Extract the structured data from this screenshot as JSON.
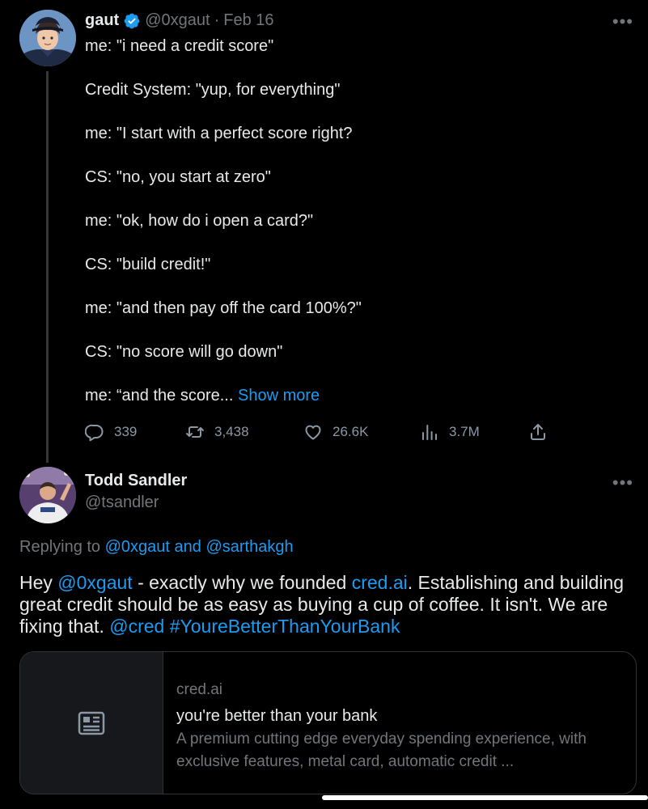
{
  "tweet1": {
    "author_name": "gaut",
    "author_handle": "@0xgaut",
    "separator": "·",
    "date": "Feb 16",
    "lines": [
      "me: \"i need a credit score\"",
      "Credit System: \"yup, for everything\"",
      "me: \"I start with a perfect score right?",
      "CS: \"no, you start at zero\"",
      "me: \"ok, how do i open a card?\"",
      "CS: \"build credit!\"",
      "me: \"and then pay off the card 100%?\"",
      "CS: \"no score will go down\""
    ],
    "last_line": "me: “and the score...",
    "show_more": "Show more",
    "stats": {
      "replies": "339",
      "retweets": "3,438",
      "likes": "26.6K",
      "views": "3.7M"
    }
  },
  "tweet2": {
    "author_name": "Todd Sandler",
    "author_handle": "@tsandler",
    "replying_prefix": "Replying to",
    "replying_users": "@0xgaut and @sarthakgh",
    "body": {
      "t1": "Hey ",
      "mention1": "@0xgaut",
      "t2": " - exactly why we founded ",
      "link": "cred.ai",
      "t3": ". Establishing and building great credit should be as easy as buying a cup of coffee. It isn't. We are fixing that. ",
      "mention2": "@cred",
      "t4": " ",
      "hashtag": "#YoureBetterThanYourBank"
    },
    "card": {
      "domain": "cred.ai",
      "title": "you're better than your bank",
      "description": "A premium cutting edge everyday spending experience, with exclusive features, metal card, automatic credit ..."
    }
  },
  "icons": {
    "more": "more-icon",
    "verified": "verified-badge-icon",
    "reply": "reply-icon",
    "retweet": "retweet-icon",
    "like": "heart-icon",
    "views": "views-icon",
    "share": "share-icon",
    "article": "article-icon"
  },
  "colors": {
    "background": "#000000",
    "text": "#e7e9ea",
    "muted": "#71767b",
    "link": "#1d9bf0",
    "divider": "#2f3336"
  }
}
